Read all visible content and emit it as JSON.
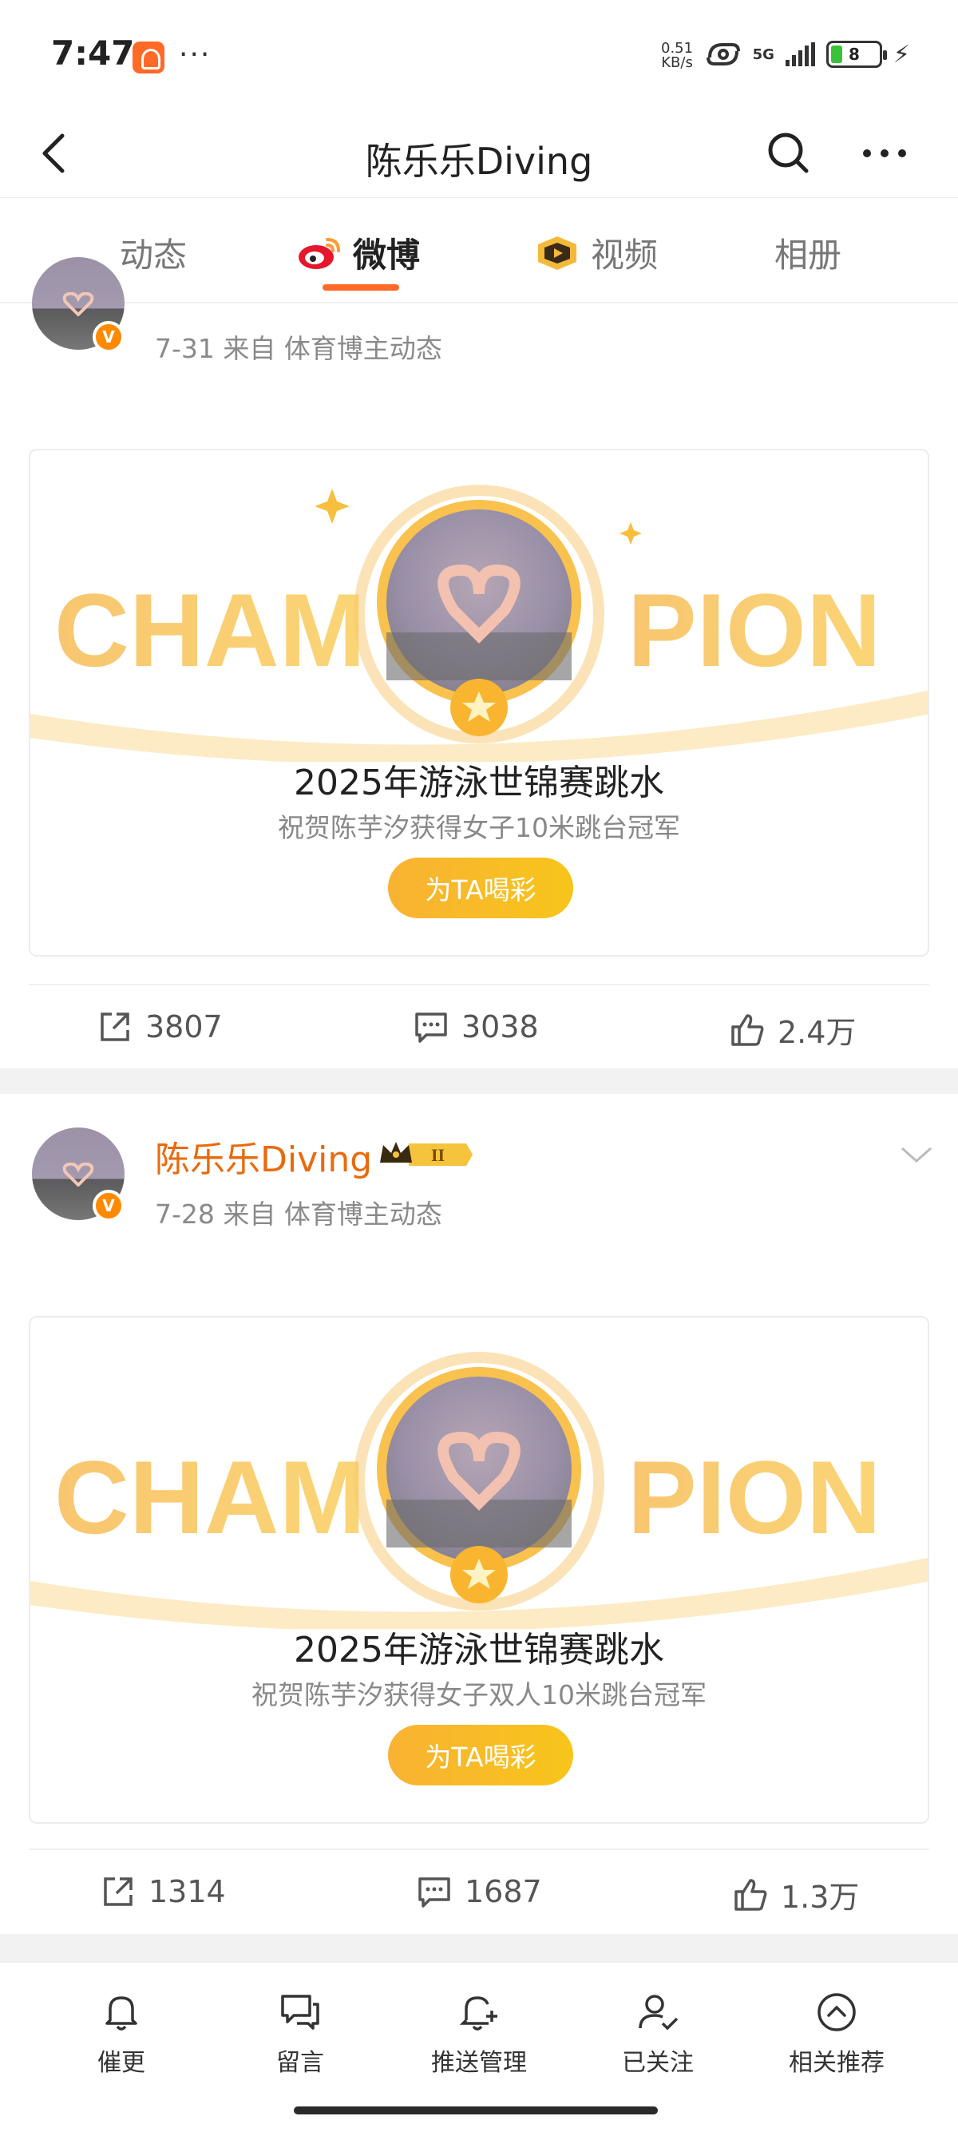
{
  "status": {
    "time": "7:47",
    "net_speed_value": "0.51",
    "net_speed_unit": "KB/s",
    "signal": "5G",
    "battery": "8"
  },
  "header": {
    "title": "陈乐乐Diving"
  },
  "tabs": [
    {
      "label": "动态",
      "active": false
    },
    {
      "label": "微博",
      "active": true
    },
    {
      "label": "视频",
      "active": false
    },
    {
      "label": "相册",
      "active": false
    }
  ],
  "posts": [
    {
      "meta": "7-31  来自 体育博主动态",
      "card_title": "2025年游泳世锦赛跳水",
      "card_sub": "祝贺陈芋汐获得女子10米跳台冠军",
      "cheer": "为TA喝彩",
      "art_left": "CHAM",
      "art_right": "PION",
      "repost": "3807",
      "comment": "3038",
      "like": "2.4万"
    },
    {
      "author": "陈乐乐Diving",
      "meta": "7-28  来自 体育博主动态",
      "card_title": "2025年游泳世锦赛跳水",
      "card_sub": "祝贺陈芋汐获得女子双人10米跳台冠军",
      "cheer": "为TA喝彩",
      "art_left": "CHAM",
      "art_right": "PION",
      "repost": "1314",
      "comment": "1687",
      "like": "1.3万"
    }
  ],
  "bottom_bar": [
    {
      "label": "催更",
      "icon": "bell-icon"
    },
    {
      "label": "留言",
      "icon": "message-icon"
    },
    {
      "label": "推送管理",
      "icon": "bell-plus-icon"
    },
    {
      "label": "已关注",
      "icon": "user-check-icon"
    },
    {
      "label": "相关推荐",
      "icon": "chevron-up-circle-icon"
    }
  ],
  "colors": {
    "accent": "#ff6a28",
    "author": "#e96a0c",
    "gold": "#f7b533"
  }
}
